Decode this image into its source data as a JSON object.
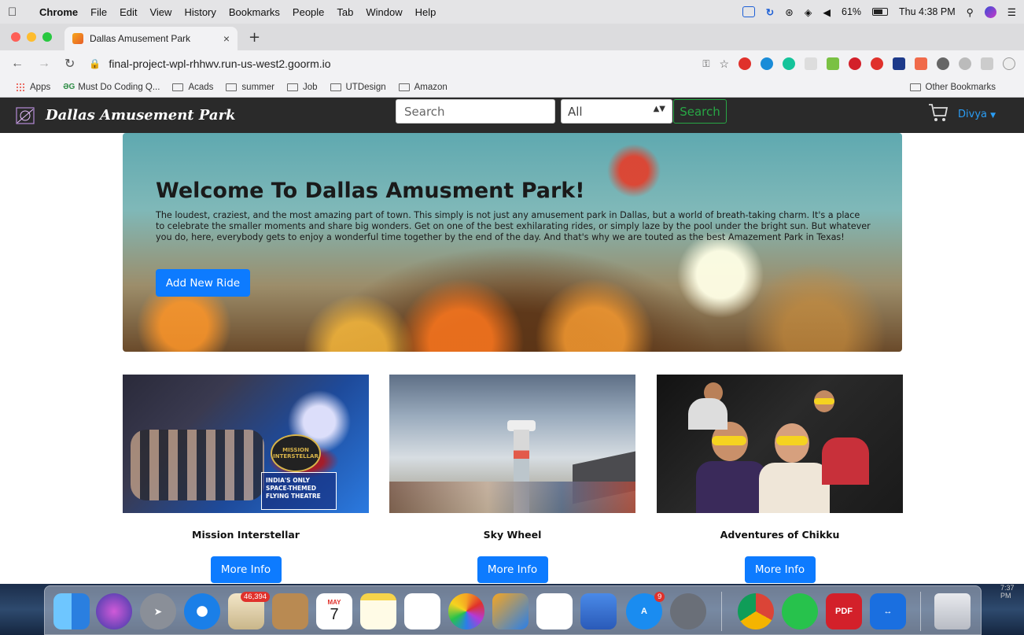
{
  "os_menubar": {
    "app": "Chrome",
    "menus": [
      "File",
      "Edit",
      "View",
      "History",
      "Bookmarks",
      "People",
      "Tab",
      "Window",
      "Help"
    ],
    "battery": "61%",
    "clock": "Thu 4:38 PM"
  },
  "browser": {
    "tab_title": "Dallas Amusement Park",
    "url": "final-project-wpl-rhhwv.run-us-west2.goorm.io",
    "bookmarks": [
      "Apps",
      "Must Do Coding Q...",
      "Acads",
      "summer",
      "Job",
      "UTDesign",
      "Amazon"
    ],
    "other_bookmarks": "Other Bookmarks"
  },
  "site": {
    "brand": "Dallas Amusement Park",
    "search_placeholder": "Search",
    "category_selected": "All",
    "search_button": "Search",
    "user_name": "Divya"
  },
  "hero": {
    "title": "Welcome To Dallas Amusment Park!",
    "text": "The loudest, craziest, and the most amazing part of town. This simply is not just any amusement park in Dallas, but a world of breath-taking charm. It's a place to celebrate the smaller moments and share big wonders. Get on one of the best exhilarating rides, or simply laze by the pool under the bright sun. But whatever you do, here, everybody gets to enjoy a wonderful time together by the end of the day. And that's why we are touted as the best Amazement Park in Texas!",
    "button": "Add New Ride"
  },
  "rides": [
    {
      "name": "Mission Interstellar",
      "button": "More Info",
      "photo_text": "INDIA'S ONLY SPACE-THEMED FLYING THEATRE",
      "logo_text": "MISSION INTERSTELLAR"
    },
    {
      "name": "Sky Wheel",
      "button": "More Info"
    },
    {
      "name": "Adventures of Chikku",
      "button": "More Info"
    }
  ],
  "dock": {
    "mail_badge": "46,394",
    "calendar_month": "MAY",
    "calendar_day": "7",
    "appstore_badge": "9",
    "pdf_label": "PDF",
    "corner_time": "7:37 PM"
  },
  "colors": {
    "primary": "#0d7bff",
    "success": "#28a745",
    "navbar": "#2a2a2a"
  }
}
